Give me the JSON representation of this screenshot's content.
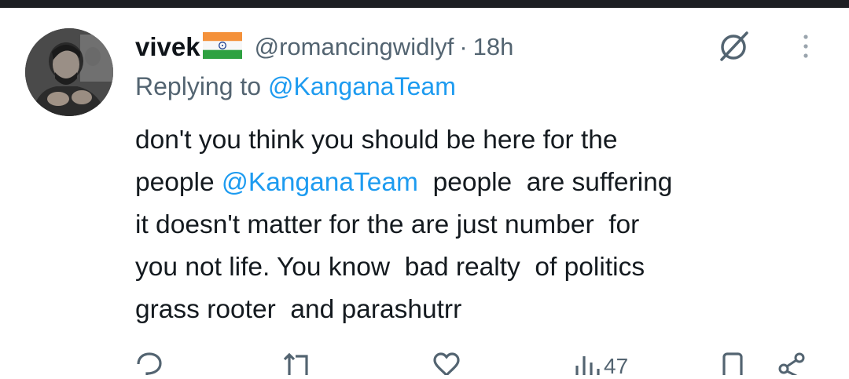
{
  "tweet": {
    "display_name": "vivek",
    "flag_icon": "india-flag-icon",
    "handle": "@romancingwidlyf",
    "separator": "·",
    "time": "18h",
    "replying_prefix": "Replying to",
    "replying_to": "@KanganaTeam",
    "body_lines": [
      {
        "before": "don't you think you should be here for the",
        "mention": "",
        "after": ""
      },
      {
        "before": "people ",
        "mention": "@KanganaTeam",
        "after": "  people  are suffering"
      },
      {
        "before": "it doesn't matter for the are just number  for",
        "mention": "",
        "after": ""
      },
      {
        "before": "you not life. You know  bad realty  of politics",
        "mention": "",
        "after": ""
      },
      {
        "before": "grass rooter  and parashutrr",
        "mention": "",
        "after": ""
      }
    ]
  },
  "actions": {
    "reply_icon": "reply-icon",
    "retweet_icon": "retweet-icon",
    "like_icon": "like-icon",
    "views_icon": "views-icon",
    "views_count": "47",
    "bookmark_icon": "bookmark-icon",
    "share_icon": "share-icon"
  },
  "colors": {
    "text": "#141a1f",
    "muted": "#536471",
    "mention": "#1d9bf0",
    "top_bar": "#1d1f23"
  }
}
